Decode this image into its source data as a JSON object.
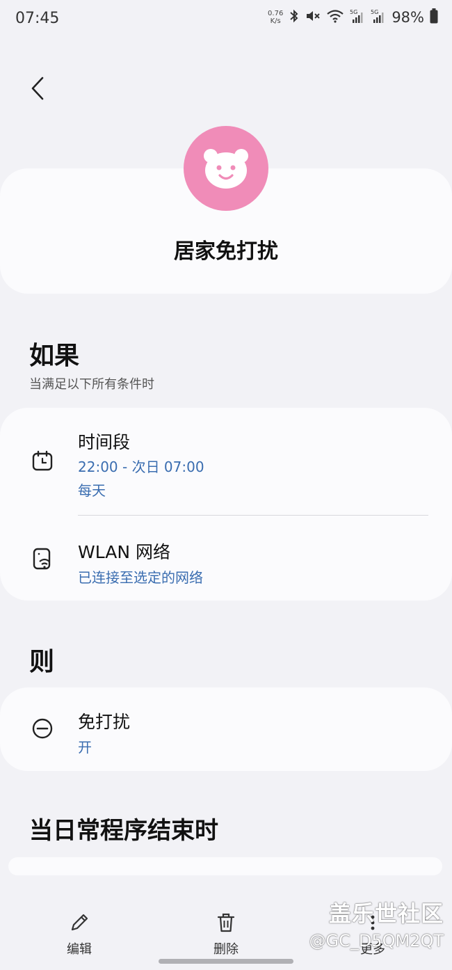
{
  "status_bar": {
    "time": "07:45",
    "net_speed_value": "0.76",
    "net_speed_unit": "K/s",
    "battery": "98%",
    "icons": [
      "bluetooth-icon",
      "mute-icon",
      "wifi-icon",
      "signal-5g-icon",
      "signal-5g-icon",
      "battery-icon"
    ]
  },
  "header": {
    "back_icon": "chevron-left-icon",
    "avatar_icon": "bear-icon",
    "avatar_color": "#f08cb8",
    "title": "居家免打扰"
  },
  "if_section": {
    "title": "如果",
    "subtitle": "当满足以下所有条件时",
    "conditions": [
      {
        "icon": "calendar-icon",
        "title": "时间段",
        "detail": "22:00 - 次日 07:00",
        "detail2": "每天"
      },
      {
        "icon": "wifi-phone-icon",
        "title": "WLAN 网络",
        "detail": "已连接至选定的网络"
      }
    ]
  },
  "then_section": {
    "title": "则",
    "actions": [
      {
        "icon": "do-not-disturb-icon",
        "title": "免打扰",
        "detail": "开"
      }
    ]
  },
  "end_section": {
    "title": "当日常程序结束时"
  },
  "bottom_bar": {
    "edit_label": "编辑",
    "delete_label": "删除",
    "more_label": "更多"
  },
  "watermark": {
    "line1": "盖乐世社区",
    "line2": "@GC_D5QM2QT"
  },
  "colors": {
    "background": "#f2f2f6",
    "card": "#fbfbfd",
    "accent_text": "#3a6db0"
  }
}
